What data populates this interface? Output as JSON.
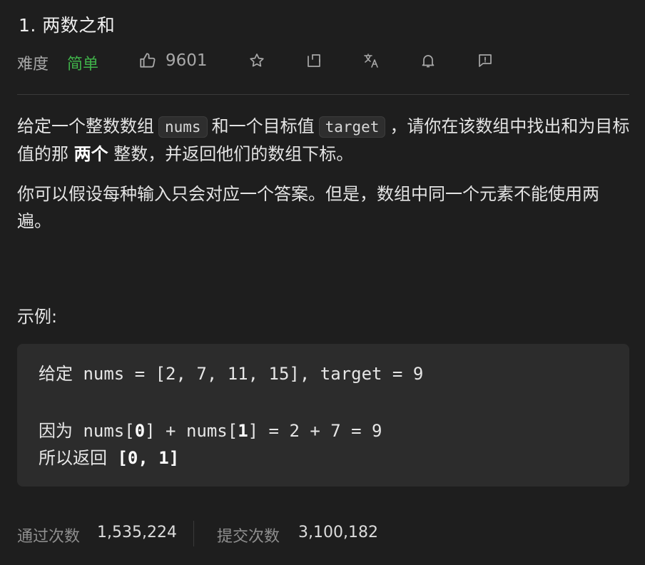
{
  "problem": {
    "title": "1. 两数之和",
    "difficulty_label": "难度",
    "difficulty_value": "简单",
    "like_count": "9601",
    "colors": {
      "easy": "#40b34a",
      "text_muted": "#a8a8a8",
      "background": "#1e1e1e"
    }
  },
  "toolbar": {
    "icons": [
      "thumbs-up-icon",
      "star-icon",
      "share-icon",
      "translate-icon",
      "bell-icon",
      "feedback-icon"
    ]
  },
  "description": {
    "p1_a": "给定一个整数数组",
    "p1_code1": "nums",
    "p1_b": "和一个目标值",
    "p1_code2": "target",
    "p1_c": "，请你在该数组中找出和为目标值的那",
    "p1_strong": "两个",
    "p1_d": "整数，并返回他们的数组下标。",
    "p2": "你可以假设每种输入只会对应一个答案。但是，数组中同一个元素不能使用两遍。"
  },
  "example": {
    "title": "示例:",
    "line1": "给定 nums = [2, 7, 11, 15], target = 9",
    "line2_a": "因为 nums[",
    "line2_b1": "0",
    "line2_c": "] + nums[",
    "line2_b2": "1",
    "line2_d": "] = 2 + 7 = 9",
    "line3_a": "所以返回 ",
    "line3_b": "[0, 1]",
    "line3_c": "]"
  },
  "stats": {
    "accepted_label": "通过次数",
    "accepted_value": "1,535,224",
    "submissions_label": "提交次数",
    "submissions_value": "3,100,182"
  }
}
